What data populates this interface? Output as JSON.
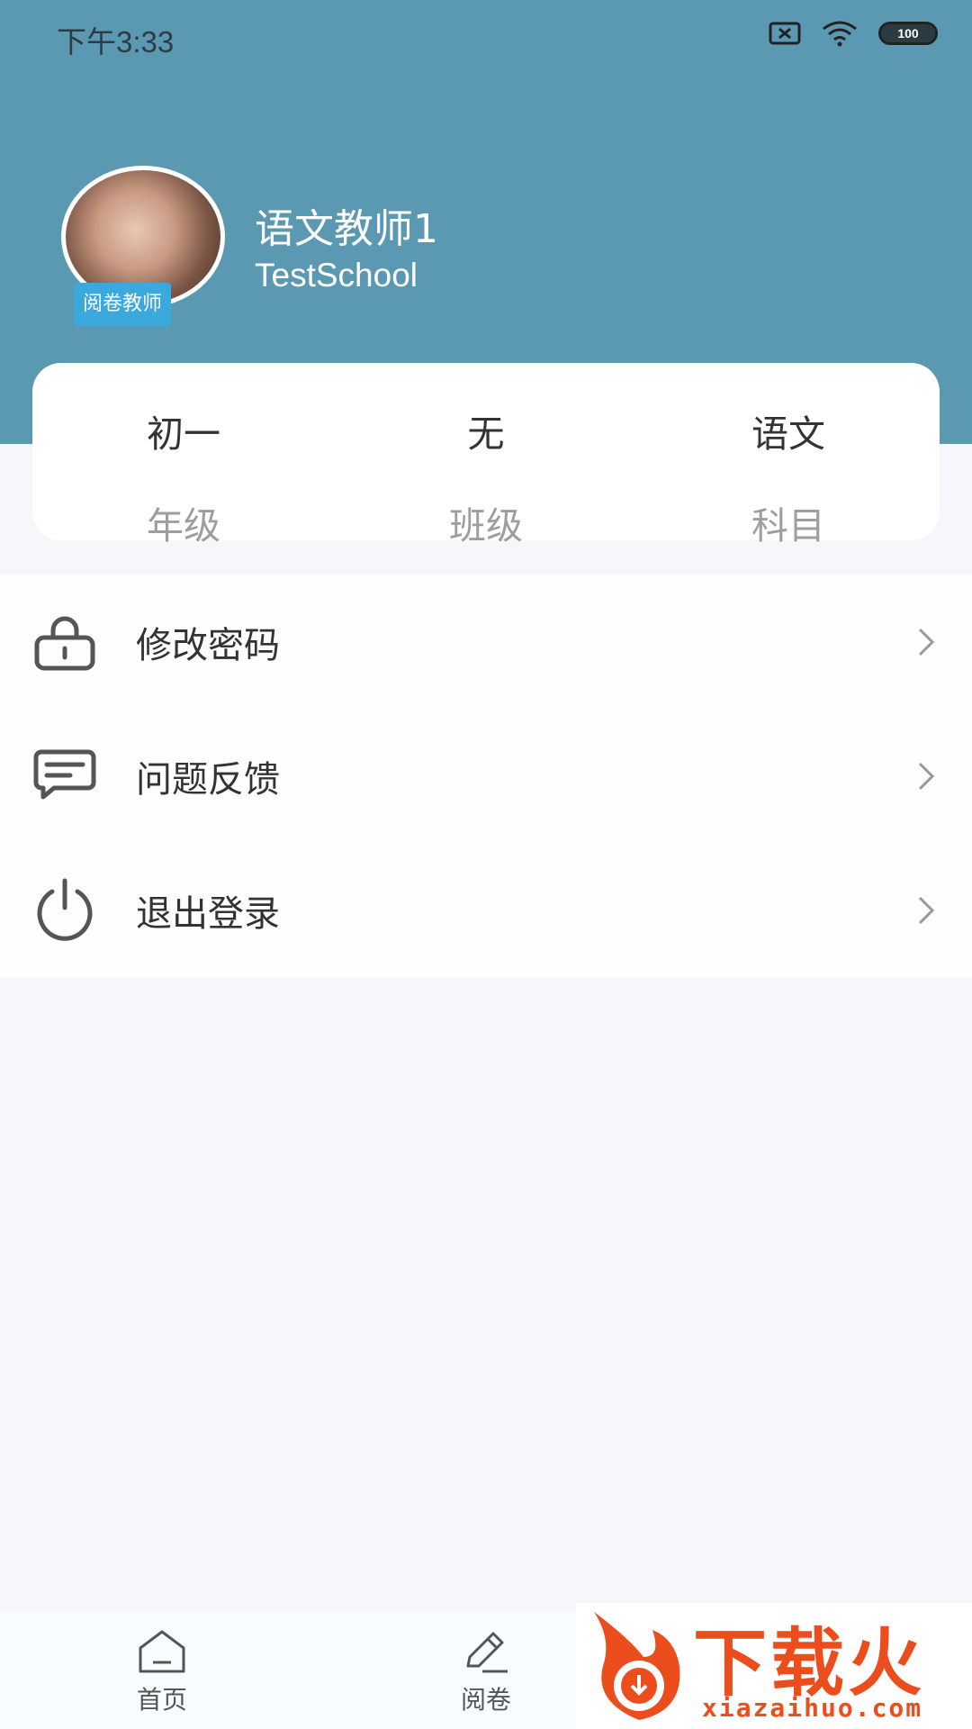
{
  "status_bar": {
    "time": "下午3:33",
    "battery": "100",
    "icons": [
      "sim-x-icon",
      "wifi-icon",
      "battery-icon"
    ]
  },
  "profile": {
    "name": "语文教师1",
    "school": "TestSchool",
    "role_badge": "阅卷教师"
  },
  "info_card": [
    {
      "value": "初一",
      "label": "年级"
    },
    {
      "value": "无",
      "label": "班级"
    },
    {
      "value": "语文",
      "label": "科目"
    }
  ],
  "menu": [
    {
      "label": "修改密码",
      "icon": "lock-icon"
    },
    {
      "label": "问题反馈",
      "icon": "feedback-icon"
    },
    {
      "label": "退出登录",
      "icon": "power-icon"
    }
  ],
  "tabbar": [
    {
      "label": "首页",
      "icon": "home-icon"
    },
    {
      "label": "阅卷",
      "icon": "edit-icon"
    }
  ],
  "watermark": {
    "title": "下载火",
    "site": "xiazaihuo.com"
  },
  "colors": {
    "header_bg": "#5b99b2",
    "badge_bg": "#3aa9dc",
    "page_bg": "#f6f7fa",
    "watermark": "#ec4d1c"
  }
}
